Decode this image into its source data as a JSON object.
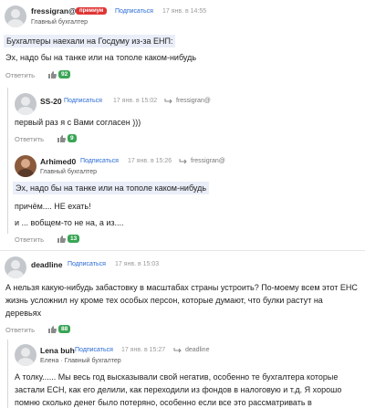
{
  "comments": [
    {
      "author": "fressigran@",
      "premium": "премиум",
      "subscribe": "Подписаться",
      "date": "17 янв. в 14:55",
      "role": "Главный бухгалтер",
      "quote": "Бухгалтеры наехали на Госдуму из-за ЕНП:",
      "text": "Эх, надо бы на танке или на тополе каком-нибудь",
      "reply": "Ответить",
      "likes": "92"
    },
    {
      "author": "SS-20",
      "subscribe": "Подписаться",
      "date": "17 янв. в 15:02",
      "reply_to": "fressigran@",
      "text": "первый раз я с Вами согласен )))",
      "reply": "Ответить",
      "likes": "9"
    },
    {
      "author": "Arhimed0",
      "subscribe": "Подписаться",
      "date": "17 янв. в 15:26",
      "reply_to": "fressigran@",
      "role": "Главный бухгалтер",
      "quote": "Эх, надо бы на танке или на тополе каком-нибудь",
      "text1": "причём.... НЕ ехать!",
      "text2": "и ... вобщем-то не на, а из....",
      "reply": "Ответить",
      "likes": "13"
    },
    {
      "author": "deadline",
      "subscribe": "Подписаться",
      "date": "17 янв. в 15:03",
      "text": "А нельзя какую-нибудь забастовку в масштабах страны устроить? По-моему всем этот ЕНС жизнь усложнил ну кроме тех особых персон, которые думают, что булки растут на деревьях",
      "reply": "Ответить",
      "likes": "88"
    },
    {
      "author": "Lena buh",
      "subscribe": "Подписаться",
      "date": "17 янв. в 15:27",
      "reply_to": "deadline",
      "role": "Елена · Главный бухгалтер",
      "text": "А толку...... Мы весь год высказывали свой негатив, особенно те бухгалтера которые застали ЕСН, как его делили, как переходили из фондов в налоговую и т.д. Я хорошо помню сколько денег было потеряно, особенно если все это рассматривать в"
    }
  ],
  "colors": {
    "accent": "#2a6bd6",
    "like_badge": "#3aa556",
    "premium": "#e03535",
    "quote_bg": "#eaeef8"
  },
  "icons": {
    "like": "thumbs-up-icon",
    "reply_arrow": "reply-arrow-icon",
    "avatar": "avatar-icon"
  }
}
